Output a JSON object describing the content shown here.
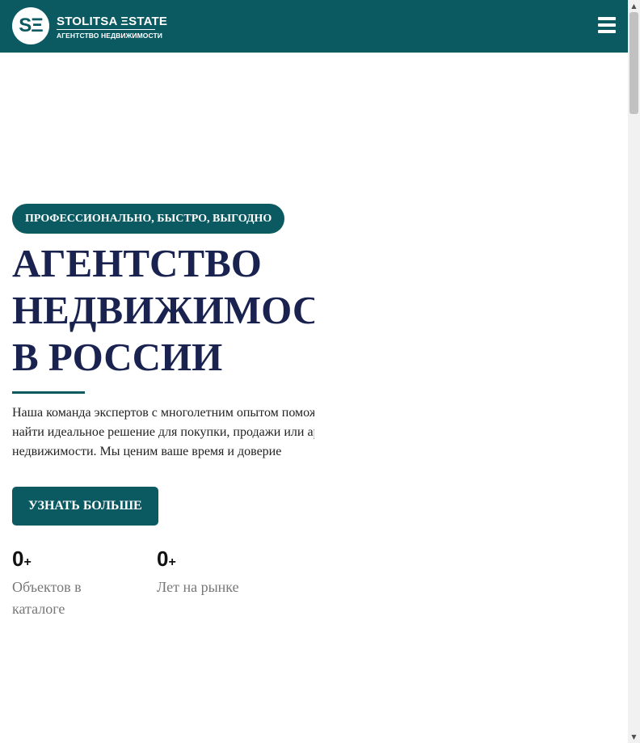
{
  "header": {
    "logo_mark": "SΞ",
    "logo_name": "STOLITSA ΞSTATE",
    "logo_subtitle": "АГЕНТСТВО НЕДВИЖИМОСТИ",
    "menu_icon": "hamburger-icon",
    "background_color": "#0b5a62"
  },
  "hero": {
    "badge": "ПРОФЕССИОНАЛЬНО, БЫСТРО, ВЫГОДНО",
    "title_lines": [
      "АГЕНТСТВО",
      "НЕДВИЖИМОСТИ",
      "В РОССИИ"
    ],
    "description_lines": [
      "Наша команда экспертов с многолетним опытом поможет",
      "найти идеальное решение для покупки, продажи или аренды",
      "недвижимости. Мы ценим ваше время и доверие"
    ],
    "cta_label": "УЗНАТЬ БОЛЬШЕ"
  },
  "stats": [
    {
      "value": "0",
      "suffix": "+",
      "label_lines": [
        "Объектов в",
        "каталоге"
      ]
    },
    {
      "value": "0",
      "suffix": "+",
      "label_lines": [
        "Лет на рынке"
      ]
    }
  ],
  "colors": {
    "accent": "#0b5a62",
    "title": "#1a2350",
    "muted": "#777777"
  }
}
